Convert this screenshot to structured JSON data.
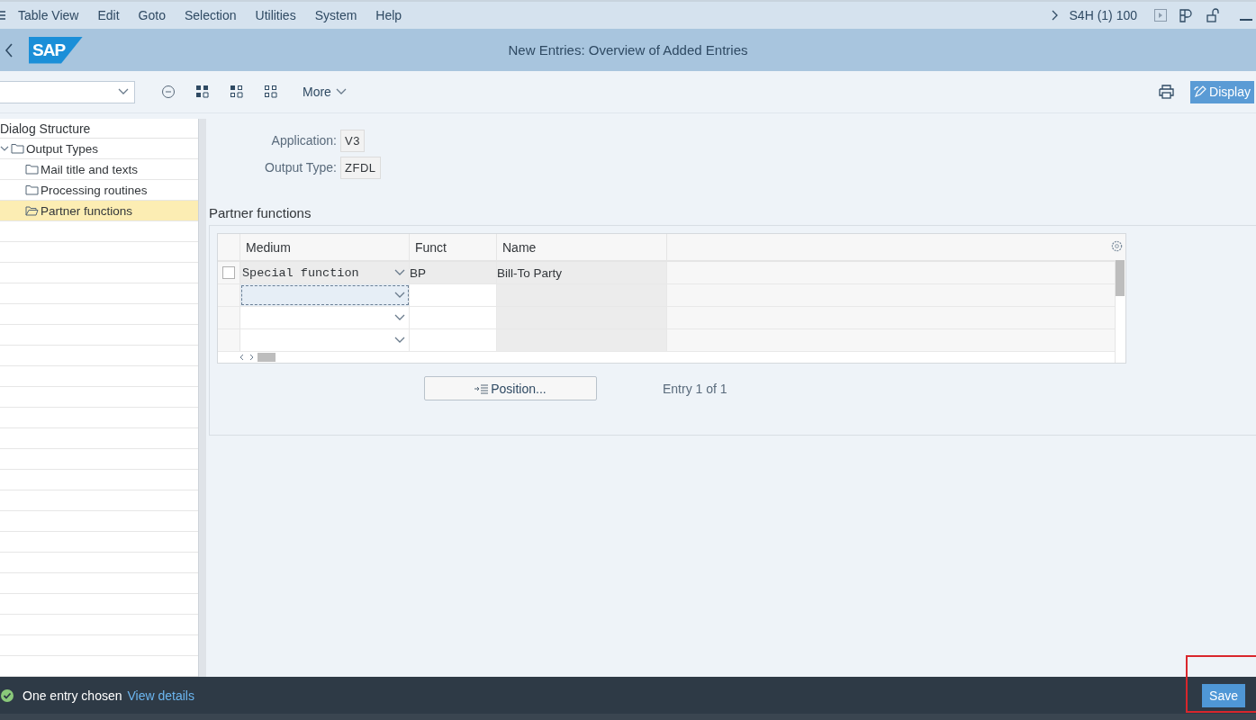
{
  "menu_bar": {
    "items": [
      "Table View",
      "Edit",
      "Goto",
      "Selection",
      "Utilities",
      "System",
      "Help"
    ],
    "system": "S4H (1) 100"
  },
  "title_bar": {
    "logo": "SAP",
    "title": "New Entries: Overview of Added Entries"
  },
  "toolbar": {
    "more": "More",
    "display_button": "Display"
  },
  "dialog_structure": {
    "title": "Dialog Structure",
    "items": [
      {
        "label": "Output Types",
        "expanded": true,
        "selected": false,
        "children": [
          {
            "label": "Mail title and texts",
            "selected": false
          },
          {
            "label": "Processing routines",
            "selected": false
          },
          {
            "label": "Partner functions",
            "selected": true
          }
        ]
      }
    ]
  },
  "header_fields": [
    {
      "label": "Application:",
      "value": "V3"
    },
    {
      "label": "Output Type:",
      "value": "ZFDL"
    }
  ],
  "section_title": "Partner functions",
  "table": {
    "columns": [
      "Medium",
      "Funct",
      "Name"
    ],
    "rows": [
      {
        "medium": "Special function",
        "funct": "BP",
        "name": "Bill-To Party",
        "focused": false,
        "checked": false
      },
      {
        "focused": true
      },
      {
        "focused": false
      },
      {
        "focused": false
      }
    ]
  },
  "position_button": "Position...",
  "entry_count": "Entry 1 of 1",
  "status_bar": {
    "kind": "success",
    "message": "One entry chosen",
    "link": "View details",
    "save_button": "Save",
    "save_highlighted": true
  }
}
